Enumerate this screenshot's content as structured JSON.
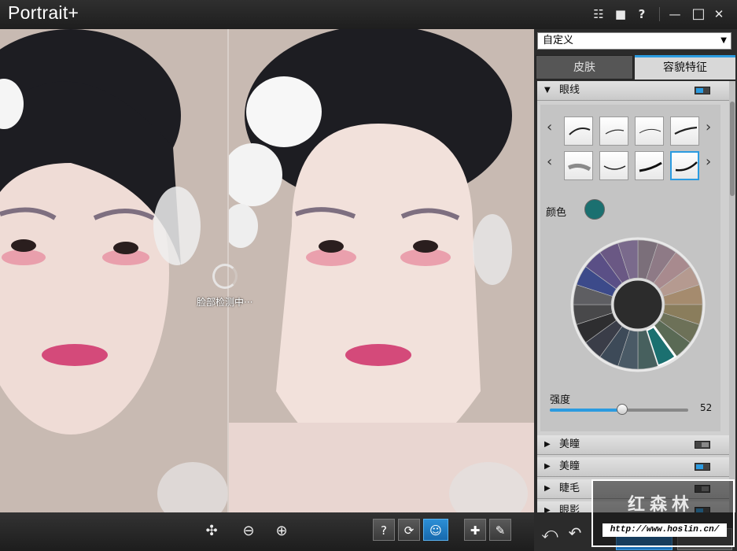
{
  "app": {
    "title": "Portrait+"
  },
  "titlebar": {
    "icons": [
      "list-icon",
      "comment-icon",
      "help-icon",
      "minimize-icon",
      "maximize-icon",
      "close-icon"
    ],
    "glyphs": {
      "list": "☷",
      "comment": "■",
      "help": "?",
      "minimize": "—",
      "maximize": "□",
      "close": "✕"
    }
  },
  "viewer": {
    "detecting_text": "脸部检测中···",
    "face_colors": {
      "skin": "#efdcd6",
      "hair": "#1d1d22",
      "lips": "#d44a7a",
      "eyeshadow": "#e7849a",
      "background": "#c6b8b0"
    }
  },
  "bottombar": {
    "fit_icon": "✣",
    "zoom_out_icon": "⊖",
    "zoom_in_icon": "⊕",
    "help_label": "?",
    "swap_icon": "⟳",
    "face_icon": "☺",
    "bandage_icon": "✚",
    "brush_icon": "✎"
  },
  "panel": {
    "preset": {
      "value": "自定义"
    },
    "tabs": {
      "skin": "皮肤",
      "features": "容貌特征"
    },
    "eyeline": {
      "title": "眼线",
      "toggle": "on",
      "nav_left": "‹",
      "nav_right": "›",
      "color_label": "颜色",
      "color": "#1b7070",
      "strength_label": "强度",
      "strength": 52,
      "strength_max": 100
    },
    "sections": [
      {
        "title": "美瞳",
        "toggle": "off"
      },
      {
        "title": "美瞳",
        "toggle": "on"
      },
      {
        "title": "睫毛",
        "toggle": "off"
      },
      {
        "title": "眼影",
        "toggle": "on"
      }
    ],
    "footer": {
      "undo_all_icon": "⤺",
      "undo_icon": "↶"
    }
  },
  "watermark": {
    "brand": "红森林",
    "url": "http://www.hoslin.cn/"
  },
  "accent": "#2b9be0"
}
